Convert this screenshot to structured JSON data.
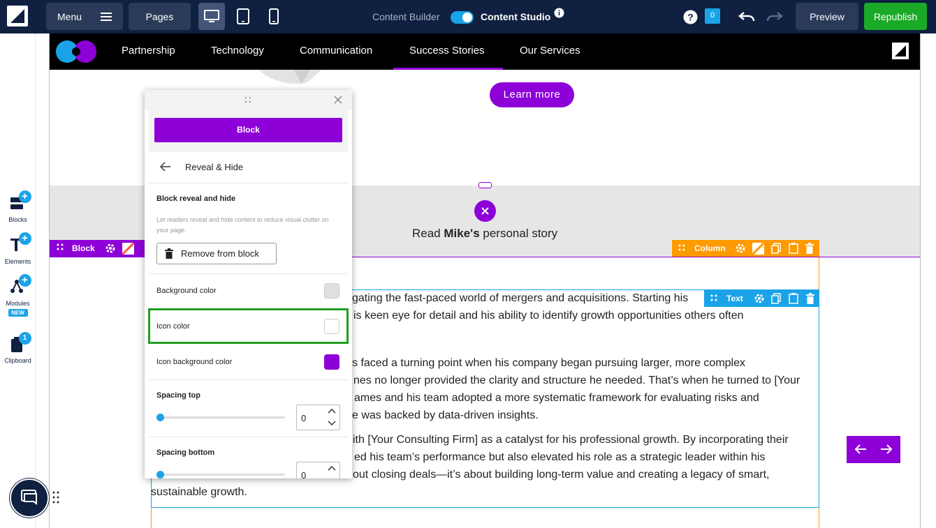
{
  "topbar": {
    "menu_label": "Menu",
    "pages_label": "Pages",
    "content_builder_label": "Content Builder",
    "content_studio_label": "Content Studio",
    "notifications_count": "0",
    "preview_label": "Preview",
    "republish_label": "Republish"
  },
  "sidebar": {
    "items": [
      {
        "label": "Blocks"
      },
      {
        "label": "Elements"
      },
      {
        "label": "Modules",
        "badge": "NEW"
      },
      {
        "label": "Clipboard",
        "count": "1"
      }
    ]
  },
  "site_nav": {
    "items": [
      "Partnership",
      "Technology",
      "Communication",
      "Success Stories",
      "Our Services"
    ],
    "active_index": 3
  },
  "hero": {
    "button_label": "Learn more"
  },
  "reveal": {
    "prefix": "Read ",
    "name": "Mike's",
    "suffix": " personal story"
  },
  "toolbars": {
    "block_label": "Block",
    "column_label": "Column",
    "text_label": "Text"
  },
  "body_lines": [
    "gating the fast-paced world of mergers and acquisitions. Starting his",
    "is keen eye for detail and his ability to identify growth opportunities others often",
    "s faced a turning point when his company began pursuing larger, more complex",
    "nes no longer provided the clarity and structure he needed. That’s when he turned to [Your",
    "ames and his team adopted a more systematic framework for evaluating risks and",
    "e was backed by data-driven insights.",
    "ith [Your Consulting Firm] as a catalyst for his professional growth. By incorporating their",
    "ed his team’s performance but also elevated his role as a strategic leader within his",
    "out closing deals—it’s about building long-term value and creating a legacy of smart,",
    "sustainable growth."
  ],
  "panel": {
    "tab_label": "Block",
    "section_title": "Reveal & Hide",
    "heading": "Block reveal and hide",
    "description": "Let readers reveal and hide content to reduce visual clutter on your page.",
    "remove_label": "Remove from block",
    "background_color_label": "Background color",
    "icon_color_label": "Icon color",
    "icon_bg_color_label": "Icon background color",
    "spacing_top_label": "Spacing top",
    "spacing_top_value": "0",
    "spacing_bottom_label": "Spacing bottom",
    "spacing_bottom_value": "0"
  },
  "colors": {
    "topbar_bg": "#0f2040",
    "accent_purple": "#8e00d8",
    "republish_green": "#1aaa27",
    "column_orange": "#ff9a00",
    "text_blue": "#1aa3e8",
    "highlight_green": "#1f9e1f",
    "background_swatch": "#e0e0e0",
    "icon_swatch": "#ffffff",
    "icon_bg_swatch": "#8e00d8"
  }
}
